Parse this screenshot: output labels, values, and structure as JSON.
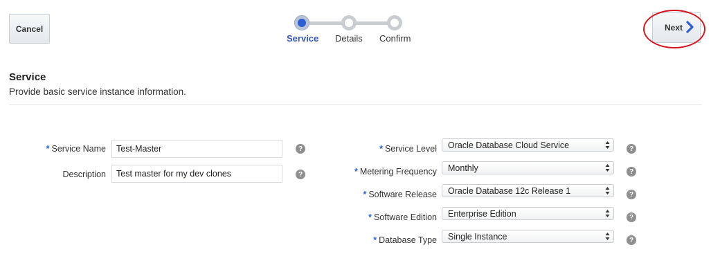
{
  "toolbar": {
    "cancel_label": "Cancel",
    "next_label": "Next"
  },
  "train": {
    "steps": [
      {
        "label": "Service",
        "state": "active"
      },
      {
        "label": "Details",
        "state": "pending"
      },
      {
        "label": "Confirm",
        "state": "pending"
      }
    ]
  },
  "section": {
    "title": "Service",
    "subtitle": "Provide basic service instance information."
  },
  "form_left": {
    "service_name": {
      "label": "Service Name",
      "required": true,
      "value": "Test-Master"
    },
    "description": {
      "label": "Description",
      "required": false,
      "value": "Test master for my dev clones"
    }
  },
  "form_right": {
    "service_level": {
      "label": "Service Level",
      "required": true,
      "value": "Oracle Database Cloud Service"
    },
    "metering_frequency": {
      "label": "Metering Frequency",
      "required": true,
      "value": "Monthly"
    },
    "software_release": {
      "label": "Software Release",
      "required": true,
      "value": "Oracle Database 12c Release 1"
    },
    "software_edition": {
      "label": "Software Edition",
      "required": true,
      "value": "Enterprise Edition"
    },
    "database_type": {
      "label": "Database Type",
      "required": true,
      "value": "Single Instance"
    }
  },
  "help_glyph": "?",
  "required_glyph": "*",
  "colors": {
    "accent": "#2d5fd3",
    "highlight_ring": "#d6141d",
    "train_idle": "#c9ccd0"
  },
  "icons": {
    "next": "chevron-right-icon",
    "help": "question-circle-icon",
    "select": "updown-arrows-icon"
  }
}
